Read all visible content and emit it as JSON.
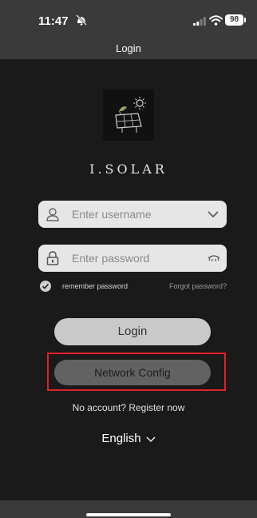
{
  "status_bar": {
    "time": "11:47",
    "battery": "98",
    "icons": [
      "silent-mode-icon",
      "signal-icon",
      "wifi-icon",
      "battery-icon"
    ]
  },
  "nav": {
    "title": "Login"
  },
  "brand": {
    "name": "I.SOLAR",
    "logo_icon": "solar-panel-logo"
  },
  "form": {
    "username_placeholder": "Enter username",
    "password_placeholder": "Enter password",
    "remember_label": "remember password",
    "forgot_label": "Forgot password?",
    "icons": [
      "user-icon",
      "lock-icon",
      "chevron-down-icon",
      "eye-icon",
      "check-icon"
    ]
  },
  "buttons": {
    "login": "Login",
    "network_config": "Network Config"
  },
  "footer": {
    "register": "No account? Register now",
    "language": "English"
  },
  "colors": {
    "background": "#1a1a1a",
    "bars": "#3a3a3a",
    "field": "#e6e6e6",
    "login_button": "#c9c9c9",
    "network_button": "#626262",
    "highlight_outline": "#e0202a"
  }
}
